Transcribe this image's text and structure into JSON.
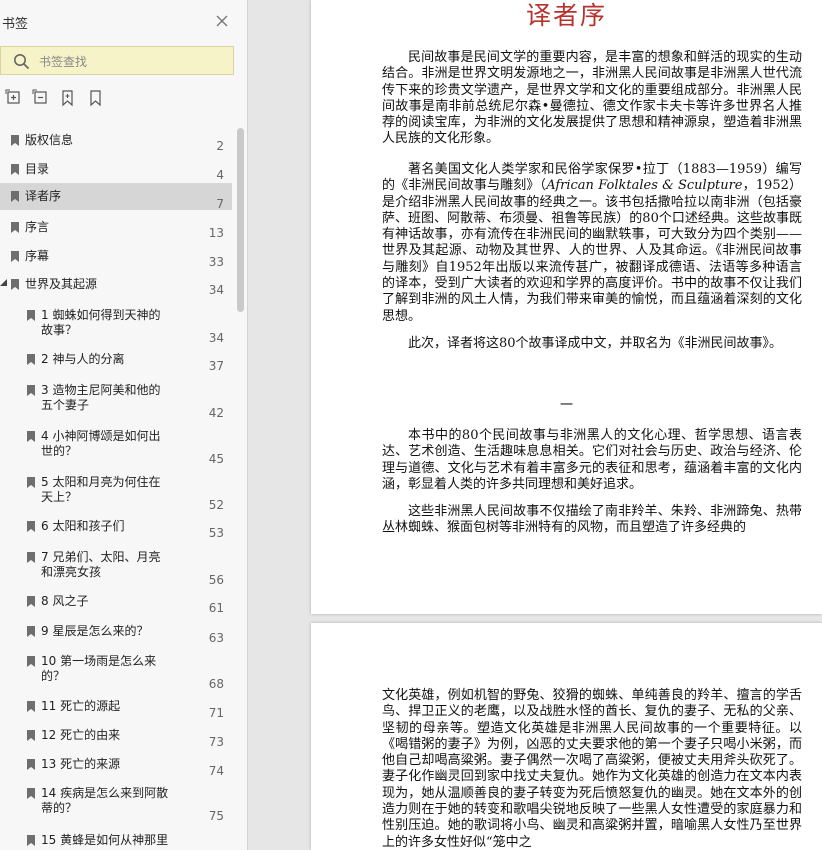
{
  "sidebar": {
    "title": "书签",
    "search_placeholder": "书签查找",
    "items": [
      {
        "label": "版权信息",
        "page": "2",
        "level": 0
      },
      {
        "label": "目录",
        "page": "4",
        "level": 0
      },
      {
        "label": "译者序",
        "page": "7",
        "level": 0,
        "selected": true
      },
      {
        "label": "序言",
        "page": "13",
        "level": 0
      },
      {
        "label": "序幕",
        "page": "33",
        "level": 0
      },
      {
        "label": "世界及其起源",
        "page": "34",
        "level": 0,
        "expanded": true
      },
      {
        "label": "1 蜘蛛如何得到天神的故事？",
        "page": "34",
        "level": 1
      },
      {
        "label": "2 神与人的分离",
        "page": "37",
        "level": 1
      },
      {
        "label": "3 造物主尼阿美和他的五个妻子",
        "page": "42",
        "level": 1
      },
      {
        "label": "4 小神阿博颂是如何出世的？",
        "page": "45",
        "level": 1
      },
      {
        "label": "5 太阳和月亮为何住在天上？",
        "page": "52",
        "level": 1
      },
      {
        "label": "6 太阳和孩子们",
        "page": "53",
        "level": 1
      },
      {
        "label": "7 兄弟们、太阳、月亮和漂亮女孩",
        "page": "56",
        "level": 1
      },
      {
        "label": "8 风之子",
        "page": "61",
        "level": 1
      },
      {
        "label": "9 星辰是怎么来的？",
        "page": "63",
        "level": 1
      },
      {
        "label": "10 第一场雨是怎么来的？",
        "page": "68",
        "level": 1
      },
      {
        "label": "11 死亡的源起",
        "page": "71",
        "level": 1
      },
      {
        "label": "12 死亡的由来",
        "page": "73",
        "level": 1
      },
      {
        "label": "13 死亡的来源",
        "page": "74",
        "level": 1
      },
      {
        "label": "14 疾病是怎么来到阿散蒂的？",
        "page": "75",
        "level": 1
      },
      {
        "label": "15 黄蜂是如何从神那里",
        "page": "",
        "level": 1
      }
    ]
  },
  "page1": {
    "title": "译者序",
    "p1": "民间故事是民间文学的重要内容，是丰富的想象和鲜活的现实的生动结合。非洲是世界文明发源地之一，非洲黑人民间故事是非洲黑人世代流传下来的珍贵文学遗产，是世界文学和文化的重要组成部分。非洲黑人民间故事是南非前总统尼尔森•曼德拉、德文作家卡夫卡等许多世界名人推荐的阅读宝库，为非洲的文化发展提供了思想和精神源泉，塑造着非洲黑人民族的文化形象。",
    "p2a": "著名美国文化人类学家和民俗学家保罗•拉丁（1883—1959）编写的《非洲民间故事与雕刻》（",
    "p2_italic": "African Folktales & Sculpture",
    "p2b": "，1952）是介绍非洲黑人民间故事的经典之一。该书包括撒哈拉以南非洲（包括豪萨、班图、阿散蒂、布须曼、祖鲁等民族）的80个口述经典。这些故事既有神话故事，亦有流传在非洲民间的幽默轶事，可大致分为四个类别——世界及其起源、动物及其世界、人的世界、人及其命运。《非洲民间故事与雕刻》自1952年出版以来流传甚广，被翻译成德语、法语等多种语言的译本，受到广大读者的欢迎和学界的高度评价。书中的故事不仅让我们了解到非洲的风土人情，为我们带来审美的愉悦，而且蕴涵着深刻的文化思想。",
    "p3": "此次，译者将这80个故事译成中文，并取名为《非洲民间故事》。",
    "section": "一",
    "p4": "本书中的80个民间故事与非洲黑人的文化心理、哲学思想、语言表达、艺术创造、生活趣味息息相关。它们对社会与历史、政治与经济、伦理与道德、文化与艺术有着丰富多元的表征和思考，蕴涵着丰富的文化内涵，彰显着人类的许多共同理想和美好追求。",
    "p5": "这些非洲黑人民间故事不仅描绘了南非羚羊、朱羚、非洲蹄兔、热带丛林蜘蛛、猴面包树等非洲特有的风物，而且塑造了许多经典的"
  },
  "page2": {
    "p1": "文化英雄，例如机智的野兔、狡猾的蜘蛛、单纯善良的羚羊、擅言的学舌鸟、捍卫正义的老鹰，以及战胜水怪的酋长、复仇的妻子、无私的父亲、坚韧的母亲等。塑造文化英雄是非洲黑人民间故事的一个重要特征。以《喝错粥的妻子》为例，凶恶的丈夫要求他的第一个妻子只喝小米粥，而他自己却喝高粱粥。妻子偶然一次喝了高粱粥，便被丈夫用斧头砍死了。妻子化作幽灵回到家中找丈夫复仇。她作为文化英雄的创造力在文本内表现为，她从温顺善良的妻子转变为死后愤怒复仇的幽灵。她在文本外的创造力则在于她的转变和歌唱尖锐地反映了一些黑人女性遭受的家庭暴力和性别压迫。她的歌词将小鸟、幽灵和高粱粥并置，暗喻黑人女性乃至世界上的许多女性好似“笼中之"
  }
}
